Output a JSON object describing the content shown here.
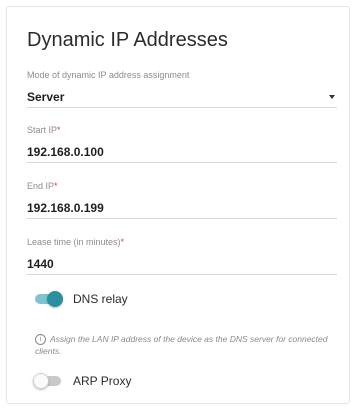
{
  "section": {
    "title": "Dynamic IP Addresses"
  },
  "mode": {
    "label": "Mode of dynamic IP address assignment",
    "value": "Server"
  },
  "start_ip": {
    "label": "Start IP",
    "required_mark": "*",
    "value": "192.168.0.100"
  },
  "end_ip": {
    "label": "End IP",
    "required_mark": "*",
    "value": "192.168.0.199"
  },
  "lease_time": {
    "label": "Lease time (in minutes)",
    "required_mark": "*",
    "value": "1440"
  },
  "dns_relay": {
    "label": "DNS relay",
    "enabled": true,
    "hint_icon": "info-icon",
    "hint": "Assign the LAN IP address of the device as the DNS server for connected clients."
  },
  "arp_proxy": {
    "label": "ARP Proxy",
    "enabled": false
  },
  "colors": {
    "accent": "#2a8fa0",
    "required": "#e0443a"
  }
}
